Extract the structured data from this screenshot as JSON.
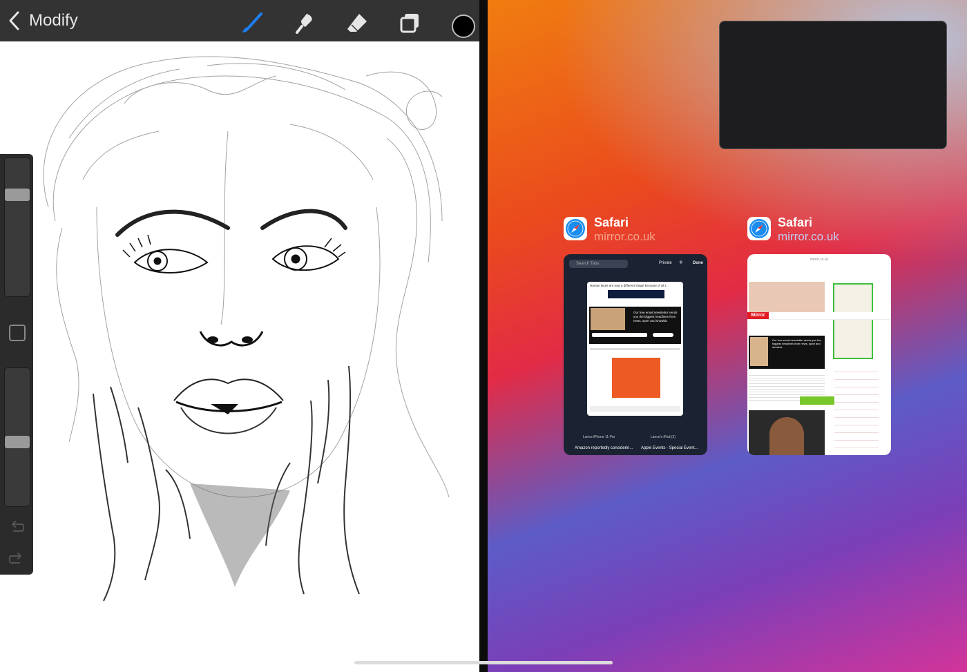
{
  "procreate": {
    "back_label": "Modify",
    "tools": [
      "brush-icon",
      "smudge-icon",
      "eraser-icon",
      "layers-icon"
    ],
    "active_tool_color": "#1e7ef0",
    "current_color": "#000000",
    "brush_size_level": 0.76,
    "opacity_level": 0.46
  },
  "switcher": {
    "cards": [
      {
        "app": "Safari",
        "url": "mirror.co.uk"
      },
      {
        "app": "Safari",
        "url": "mirror.co.uk"
      }
    ],
    "tabs_thumb": {
      "search_placeholder": "Search Tabs",
      "private": "Private",
      "plus": "+",
      "done": "Done",
      "page_headline": "Human faces are now a different shape because of all t...",
      "newsletter": "Our free email newsletter sends you the biggest headlines from news, sport and showbiz",
      "devices": [
        "Lance iPhone 11 Pro",
        "Lance's iPad (2)"
      ],
      "links": [
        "Amazon reportedly considerin...",
        "Apple Events - Special Event..."
      ]
    },
    "mirror_thumb": {
      "url": "mirror.co.uk",
      "brand": "Mirror",
      "newsletter": "Our free email newsletter sends you the biggest headlines from news, sport and showbiz"
    }
  }
}
